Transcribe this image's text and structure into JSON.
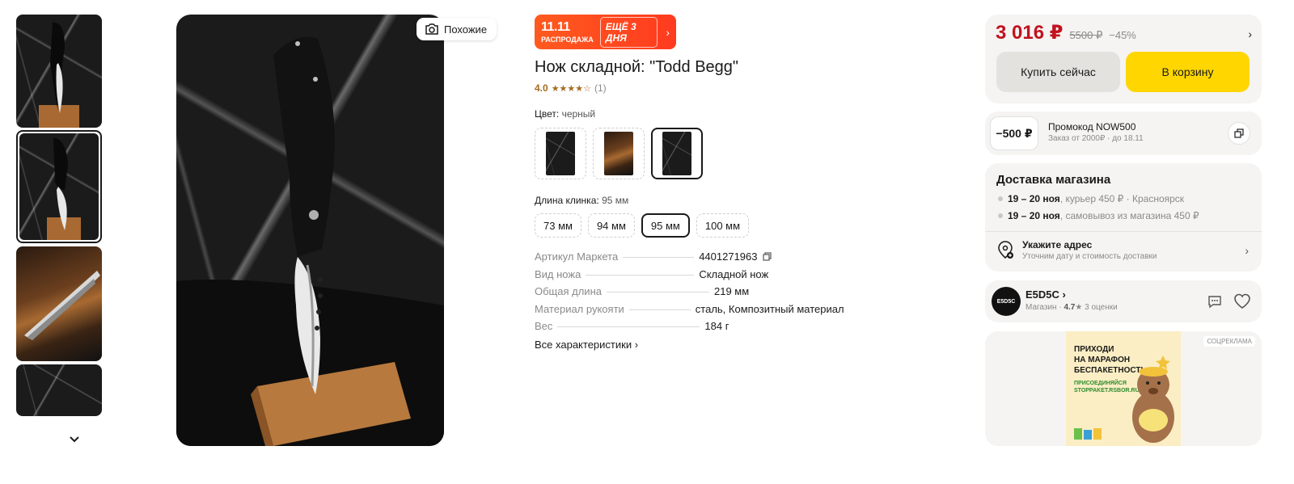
{
  "gallery": {
    "thumbnails": [
      {
        "name": "thumb-1"
      },
      {
        "name": "thumb-2",
        "active": true
      },
      {
        "name": "thumb-3"
      },
      {
        "name": "thumb-4"
      }
    ],
    "similar_label": "Похожие"
  },
  "sale": {
    "date": "11.11",
    "subtitle": "РАСПРОДАЖА",
    "days_left": "ЕЩЁ 3 ДНЯ"
  },
  "product": {
    "title": "Нож складной: \"Todd Begg\"",
    "rating": "4.0",
    "stars": "★★★★☆",
    "reviews_count": "(1)",
    "color_label": "Цвет:",
    "color_value": "черный",
    "blade_label": "Длина клинка:",
    "blade_value": "95 мм",
    "blade_options": [
      "73 мм",
      "94 мм",
      "95 мм",
      "100 мм"
    ],
    "specs": [
      {
        "key": "Артикул Маркета",
        "value": "4401271963"
      },
      {
        "key": "Вид ножа",
        "value": "Складной нож"
      },
      {
        "key": "Общая длина",
        "value": "219 мм"
      },
      {
        "key": "Материал рукояти",
        "value": "сталь, Композитный материал"
      },
      {
        "key": "Вес",
        "value": "184 г"
      }
    ],
    "all_specs_label": "Все характеристики"
  },
  "purchase": {
    "price": "3 016 ₽",
    "old_price": "5500 ₽",
    "discount": "−45%",
    "buy_now_label": "Купить сейчас",
    "cart_label": "В корзину"
  },
  "promo": {
    "amount": "−500 ₽",
    "title": "Промокод NOW500",
    "subtitle": "Заказ от 2000₽ · до 18.11"
  },
  "delivery": {
    "title": "Доставка магазина",
    "lines": [
      {
        "date": "19 – 20 ноя",
        "text": ", курьер  450 ₽ · Красноярск"
      },
      {
        "date": "19 – 20 ноя",
        "text": ", самовывоз из магазина  450 ₽"
      }
    ],
    "address_title": "Укажите адрес",
    "address_sub": "Уточним дату и стоимость доставки"
  },
  "shop": {
    "logo_text": "E5D5C",
    "name": "E5D5C",
    "kind": "Магазин · ",
    "rating": "4.7",
    "ratings_count": "★ 3 оценки"
  },
  "ad": {
    "label": "СОЦРЕКЛАМА",
    "headline": "ПРИХОДИ\nНА МАРАФОН\nБЕСПАКЕТНОСТЬ",
    "sub": "ПРИСОЕДИНЯЙСЯ\nSTOPPAKET.RSBOR.RU"
  },
  "colors": {
    "price_red": "#c1121f",
    "cart_yellow": "#ffd600",
    "sale_orange": "#ff4a1f",
    "rating_gold": "#a56a1e"
  }
}
